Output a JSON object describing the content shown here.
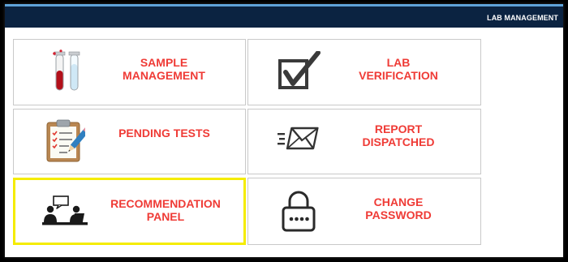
{
  "header": {
    "title": "LAB MANAGEMENT"
  },
  "menu": {
    "sample_management": {
      "line1": "SAMPLE",
      "line2": "MANAGEMENT",
      "icon": "test-tubes-icon"
    },
    "lab_verification": {
      "line1": "LAB",
      "line2": "VERIFICATION",
      "icon": "checkbox-icon"
    },
    "pending_tests": {
      "line1": "PENDING TESTS",
      "icon": "clipboard-icon"
    },
    "report_dispatched": {
      "line1": "REPORT",
      "line2": "DISPATCHED",
      "icon": "send-mail-icon"
    },
    "recommendation_panel": {
      "line1": "RECOMMENDATION",
      "line2": "PANEL",
      "icon": "presentation-icon"
    },
    "change_password": {
      "line1": "CHANGE",
      "line2": "PASSWORD",
      "icon": "padlock-icon"
    }
  },
  "colors": {
    "header_bg": "#0b2341",
    "label": "#ef3b36",
    "highlight": "#f5ec00"
  }
}
